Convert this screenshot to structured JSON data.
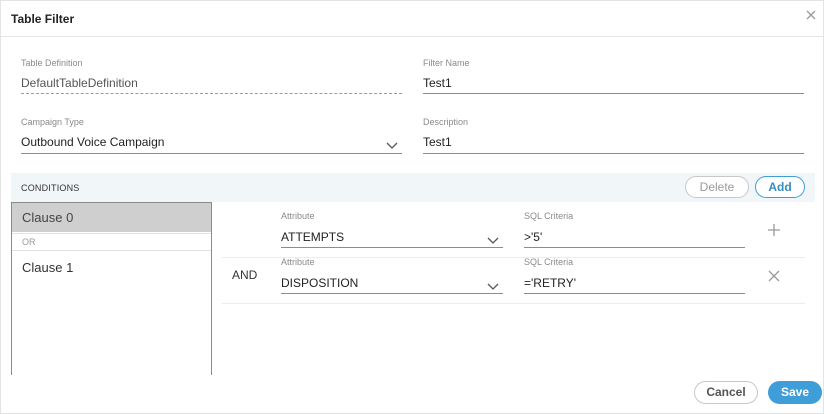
{
  "dialog": {
    "title": "Table Filter",
    "close_icon": "close-icon"
  },
  "form": {
    "table_definition": {
      "label": "Table Definition",
      "value": "DefaultTableDefinition"
    },
    "filter_name": {
      "label": "Filter Name",
      "value": "Test1"
    },
    "campaign_type": {
      "label": "Campaign Type",
      "value": "Outbound Voice Campaign"
    },
    "description": {
      "label": "Description",
      "value": "Test1"
    }
  },
  "conditions": {
    "header": "CONDITIONS",
    "delete_label": "Delete",
    "add_label": "Add",
    "clauses": [
      {
        "label": "Clause 0",
        "selected": true
      },
      {
        "label": "Clause 1",
        "selected": false
      }
    ],
    "separator": "OR",
    "rows": [
      {
        "operator": "",
        "attribute_label": "Attribute",
        "attribute": "ATTEMPTS",
        "sql_label": "SQL Criteria",
        "sql": ">'5'",
        "action_icon": "plus-icon"
      },
      {
        "operator": "AND",
        "attribute_label": "Attribute",
        "attribute": "DISPOSITION",
        "sql_label": "SQL Criteria",
        "sql": "='RETRY'",
        "action_icon": "close-icon"
      }
    ]
  },
  "footer": {
    "cancel_label": "Cancel",
    "save_label": "Save"
  },
  "colors": {
    "accent": "#3f9dd8",
    "conditions_bar": "#f1f6f9",
    "selected_clause": "#cfcfcf"
  }
}
